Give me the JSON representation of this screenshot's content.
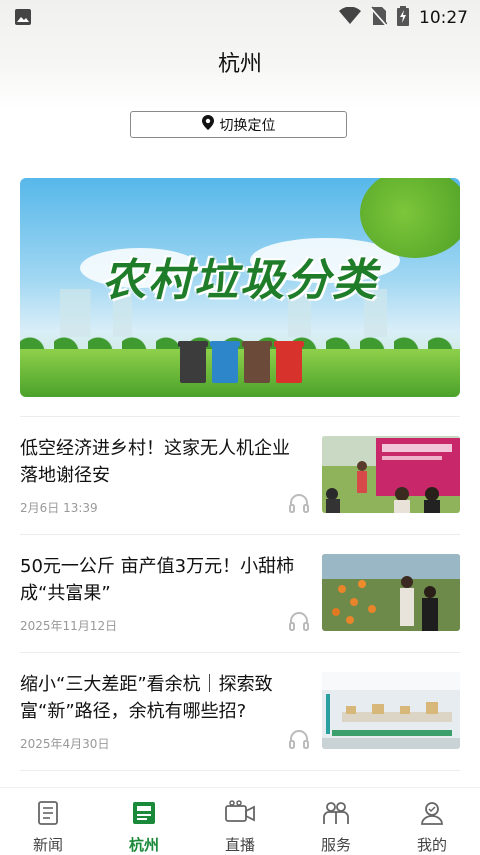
{
  "status_bar": {
    "time": "10:27",
    "icons": [
      "gallery-icon",
      "wifi-icon",
      "no-sim-icon",
      "battery-charging-icon"
    ]
  },
  "header": {
    "title": "杭州"
  },
  "location_button": {
    "label": "切换定位",
    "icon": "location-pin-icon"
  },
  "banner": {
    "title": "农村垃圾分类"
  },
  "news": [
    {
      "title": "低空经济进乡村！这家无人机企业落地谢径安",
      "date": "2月6日  13:39"
    },
    {
      "title": "50元一公斤 亩产值3万元！小甜柿成“共富果”",
      "date": "2025年11月12日"
    },
    {
      "title": "缩小“三大差距”看余杭｜探索致富“新”路径，余杭有哪些招?",
      "date": "2025年4月30日"
    }
  ],
  "tabs": [
    {
      "label": "新闻",
      "icon": "news-icon",
      "active": false
    },
    {
      "label": "杭州",
      "icon": "city-icon",
      "active": true
    },
    {
      "label": "直播",
      "icon": "live-camera-icon",
      "active": false
    },
    {
      "label": "服务",
      "icon": "service-icon",
      "active": false
    },
    {
      "label": "我的",
      "icon": "profile-icon",
      "active": false
    }
  ],
  "colors": {
    "accent": "#1a8a3a",
    "text": "#111111",
    "muted": "#999999"
  }
}
